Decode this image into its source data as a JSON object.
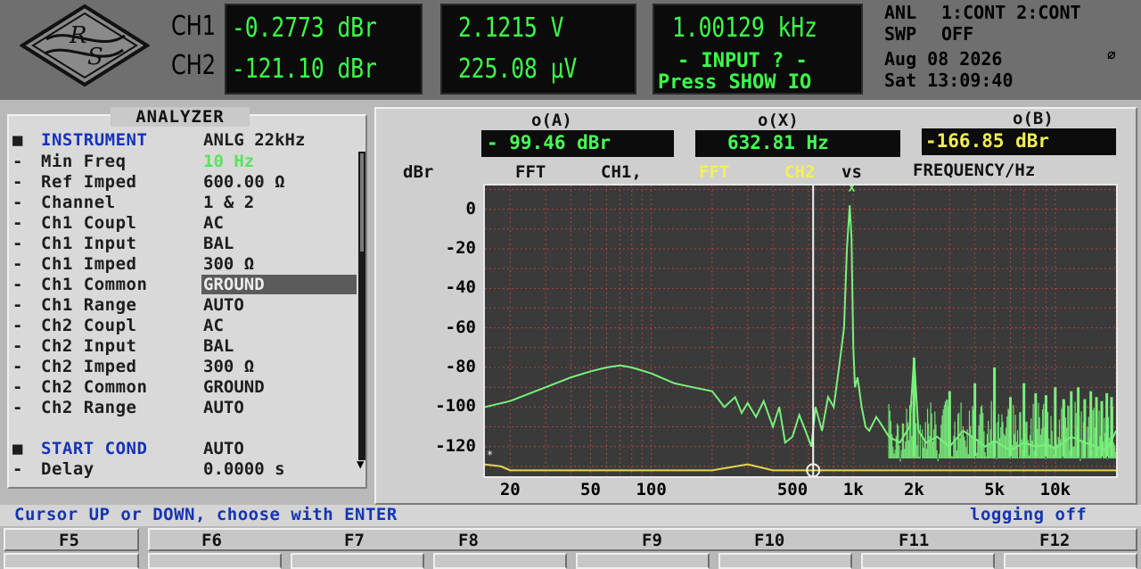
{
  "header": {
    "logo_text": "R&S",
    "ch1_label": "CH1",
    "ch2_label": "CH2",
    "ch1_level": "-0.2773 dBr",
    "ch2_level": "-121.10 dBr",
    "ch1_volt": "2.1215  V",
    "ch2_volt": "225.08 μV",
    "freq": "1.00129 kHz",
    "input_msg": "- INPUT ? -",
    "press_msg": "Press SHOW IO",
    "status": {
      "anl": "ANL",
      "anl_value": "1:CONT 2:CONT",
      "swp": "SWP",
      "swp_value": "OFF",
      "date": "Aug 08 2026",
      "datetime": "Sat 13:09:40"
    }
  },
  "analyzer": {
    "title": "ANALYZER",
    "rows": [
      {
        "bullet": "■",
        "label": "INSTRUMENT",
        "value": "ANLG   22kHz"
      },
      {
        "bullet": "-",
        "label": "Min Freq",
        "value": "10 Hz"
      },
      {
        "bullet": "-",
        "label": "Ref Imped",
        "value": "600.00 Ω"
      },
      {
        "bullet": "-",
        "label": "Channel",
        "value": "1 & 2"
      },
      {
        "bullet": "-",
        "label": "Ch1 Coupl",
        "value": "AC"
      },
      {
        "bullet": "-",
        "label": "Ch1 Input",
        "value": "BAL"
      },
      {
        "bullet": "-",
        "label": "Ch1 Imped",
        "value": "300 Ω"
      },
      {
        "bullet": "-",
        "label": "Ch1 Common",
        "value": "GROUND"
      },
      {
        "bullet": "-",
        "label": "Ch1 Range",
        "value": "AUTO"
      },
      {
        "bullet": "-",
        "label": "Ch2 Coupl",
        "value": "AC"
      },
      {
        "bullet": "-",
        "label": "Ch2 Input",
        "value": "BAL"
      },
      {
        "bullet": "-",
        "label": "Ch2 Imped",
        "value": "300 Ω"
      },
      {
        "bullet": "-",
        "label": "Ch2 Common",
        "value": "GROUND"
      },
      {
        "bullet": "-",
        "label": "Ch2 Range",
        "value": "AUTO"
      },
      {
        "bullet": "■",
        "label": "START COND",
        "value": "AUTO"
      },
      {
        "bullet": "-",
        "label": "Delay",
        "value": "0.0000 s"
      }
    ]
  },
  "graph": {
    "cursor_a_label": "o(A)",
    "cursor_x_label": "o(X)",
    "cursor_b_label": "o(B)",
    "cursor_a_value": "- 99.46 dBr",
    "cursor_x_value": "632.81  Hz",
    "cursor_b_value": "-166.85 dBr",
    "y_unit": "dBr",
    "title_fft1": "FFT",
    "title_ch1": "CH1,",
    "title_fft2": "FFT",
    "title_ch2": "CH2",
    "title_vs": "vs",
    "title_freq": "FREQUENCY/Hz"
  },
  "chart_data": {
    "type": "line",
    "xscale": "log",
    "xlim": [
      15,
      20000
    ],
    "ylim": [
      -135,
      12
    ],
    "ylabel": "dBr",
    "xlabel": "FREQUENCY/Hz",
    "yticks": [
      0,
      -20,
      -40,
      -60,
      -80,
      -100,
      -120
    ],
    "xticks": [
      {
        "v": 20,
        "label": "20"
      },
      {
        "v": 50,
        "label": "50"
      },
      {
        "v": 100,
        "label": "100"
      },
      {
        "v": 500,
        "label": "500"
      },
      {
        "v": 1000,
        "label": "1k"
      },
      {
        "v": 2000,
        "label": "2k"
      },
      {
        "v": 5000,
        "label": "5k"
      },
      {
        "v": 10000,
        "label": "10k"
      }
    ],
    "cursor_x_freq": 632.81,
    "series": [
      {
        "name": "CH1",
        "color": "#79f07c",
        "x": [
          15,
          20,
          30,
          40,
          50,
          60,
          70,
          80,
          100,
          130,
          160,
          200,
          230,
          260,
          280,
          300,
          330,
          360,
          400,
          430,
          460,
          500,
          540,
          580,
          620,
          650,
          700,
          750,
          800,
          850,
          900,
          930,
          960,
          980,
          1000,
          1020,
          1050,
          1100,
          1150,
          1200,
          1300,
          1400,
          1500,
          1700,
          1900,
          2000,
          2100,
          2300,
          2600,
          3000,
          3500,
          4000,
          4500,
          5000,
          6000,
          7000,
          8000,
          9000,
          10000,
          12000,
          14000,
          16000,
          18000,
          20000
        ],
        "y": [
          -100,
          -97,
          -90,
          -85,
          -82,
          -80,
          -79,
          -80,
          -83,
          -88,
          -90,
          -92,
          -100,
          -95,
          -103,
          -98,
          -105,
          -97,
          -110,
          -100,
          -118,
          -115,
          -104,
          -112,
          -120,
          -100,
          -112,
          -95,
          -100,
          -80,
          -60,
          -20,
          2,
          -15,
          -70,
          -90,
          -85,
          -100,
          -110,
          -112,
          -105,
          -110,
          -115,
          -118,
          -110,
          -75,
          -112,
          -118,
          -115,
          -120,
          -112,
          -116,
          -120,
          -117,
          -122,
          -118,
          -120,
          -119,
          -121,
          -115,
          -118,
          -120,
          -122,
          -112
        ]
      },
      {
        "name": "CH2",
        "color": "#e0d84a",
        "x": [
          15,
          18,
          20,
          50,
          100,
          200,
          300,
          400,
          500,
          700,
          1000,
          2000,
          5000,
          10000,
          20000
        ],
        "y": [
          -129,
          -130,
          -132,
          -132,
          -132,
          -132,
          -129,
          -132,
          -132,
          -132,
          -132,
          -132,
          -132,
          -132,
          -132
        ]
      }
    ],
    "spurs": [
      {
        "x": 2000,
        "y": -75
      },
      {
        "x": 3000,
        "y": -92
      },
      {
        "x": 4000,
        "y": -88
      },
      {
        "x": 5000,
        "y": -80
      },
      {
        "x": 6000,
        "y": -95
      },
      {
        "x": 7000,
        "y": -88
      },
      {
        "x": 8000,
        "y": -93
      },
      {
        "x": 9000,
        "y": -94
      },
      {
        "x": 10000,
        "y": -90
      },
      {
        "x": 11000,
        "y": -96
      },
      {
        "x": 12000,
        "y": -92
      },
      {
        "x": 13000,
        "y": -90
      },
      {
        "x": 14000,
        "y": -96
      },
      {
        "x": 15000,
        "y": -92
      },
      {
        "x": 16000,
        "y": -95
      },
      {
        "x": 17000,
        "y": -97
      },
      {
        "x": 18000,
        "y": -93
      },
      {
        "x": 19000,
        "y": -95
      }
    ]
  },
  "footer": {
    "hint": "Cursor UP or DOWN, choose with ENTER",
    "logging": "logging off",
    "fkeys": [
      "F5",
      "F6",
      "F7",
      "F8",
      "F9",
      "F10",
      "F11",
      "F12"
    ]
  },
  "colors": {
    "display_green": "#3cff4c",
    "menu_blue": "#1733b8",
    "trace_ch1": "#79f07c",
    "trace_ch2": "#e0d84a"
  }
}
